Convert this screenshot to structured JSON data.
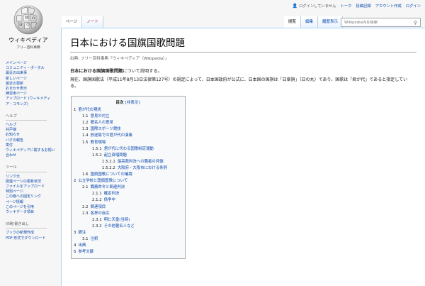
{
  "personal": {
    "anon": "ログインしていません",
    "talk": "トーク",
    "contrib": "投稿記録",
    "create": "アカウント作成",
    "login": "ログイン"
  },
  "logo": {
    "wordmark": "ウィキペディア",
    "tagline": "フリー百科事典"
  },
  "sidebar": {
    "nav": [
      "メインページ",
      "コミュニティ・ポータル",
      "最近の出来事",
      "新しいページ",
      "最近の更新",
      "おまかせ表示",
      "練習用ページ",
      "アップロード (ウィキメディア・コモンズ)"
    ],
    "help_heading": "ヘルプ",
    "help": [
      "ヘルプ",
      "井戸端",
      "お知らせ",
      "バグの報告",
      "寄付",
      "ウィキペディアに関するお問い合わせ"
    ],
    "tools_heading": "ツール",
    "tools": [
      "リンク元",
      "関連ページの更新状況",
      "ファイルをアップロード",
      "特別ページ",
      "この版への固定リンク",
      "ページ情報",
      "このページを引用",
      "ウィキデータ項目"
    ],
    "print_heading": "印刷/書き出し",
    "print": [
      "ブックの新規作成",
      "PDF 形式でダウンロード"
    ]
  },
  "tabs": {
    "page": "ページ",
    "note": "ノート",
    "read": "閲覧",
    "edit": "編集",
    "history": "履歴表示"
  },
  "search": {
    "placeholder": "Wikipedia内を検索"
  },
  "content": {
    "title": "日本における国旗国歌問題",
    "sub": "出典: フリー百科事典『ウィキペディア（Wikipedia）』",
    "lead1_bold": "日本における国旗国歌問題",
    "lead1_rest": "について説明する。",
    "lead2": "現在、国旗国歌法（平成11年8月13日法律第127号）の規定によって、日本国政府が公式に、日本国の国旗は「日章旗」（日の丸）であり、国歌は「君が代」であると指定している。"
  },
  "toc": {
    "title": "目次",
    "toggle": "[非表示]",
    "items": [
      {
        "level": 1,
        "num": "1",
        "text": "君が代の現状"
      },
      {
        "level": 2,
        "num": "1.1",
        "text": "意見の対立"
      },
      {
        "level": 2,
        "num": "1.2",
        "text": "著名人の意見"
      },
      {
        "level": 2,
        "num": "1.3",
        "text": "国際スポーツ競技"
      },
      {
        "level": 2,
        "num": "1.4",
        "text": "放送局での君が代の演奏"
      },
      {
        "level": 2,
        "num": "1.5",
        "text": "教育現場"
      },
      {
        "level": 3,
        "num": "1.5.1",
        "text": "君が代に代わる国歌制定運動"
      },
      {
        "level": 3,
        "num": "1.5.2",
        "text": "起立斉唱問題"
      },
      {
        "level": 4,
        "num": "1.5.2.1",
        "text": "最高裁判決への職者の評価"
      },
      {
        "level": 4,
        "num": "1.5.2.2",
        "text": "大阪府・大阪市における条例"
      },
      {
        "level": 2,
        "num": "1.6",
        "text": "国旗国歌についての議論"
      },
      {
        "level": 1,
        "num": "2",
        "text": "公立学校と国旗国歌について"
      },
      {
        "level": 2,
        "num": "2.1",
        "text": "職務命令と関連判決"
      },
      {
        "level": 3,
        "num": "2.1.1",
        "text": "確定判決"
      },
      {
        "level": 3,
        "num": "2.1.2",
        "text": "係争中"
      },
      {
        "level": 2,
        "num": "2.2",
        "text": "関連項目"
      },
      {
        "level": 2,
        "num": "2.3",
        "text": "各界の反応"
      },
      {
        "level": 3,
        "num": "2.3.1",
        "text": "明仁天皇(当時)"
      },
      {
        "level": 3,
        "num": "2.3.2",
        "text": "その他著名人など"
      },
      {
        "level": 1,
        "num": "3",
        "text": "脚注"
      },
      {
        "level": 2,
        "num": "3.1",
        "text": "注釈"
      },
      {
        "level": 1,
        "num": "4",
        "text": "出典"
      },
      {
        "level": 1,
        "num": "5",
        "text": "参考文献"
      }
    ]
  }
}
